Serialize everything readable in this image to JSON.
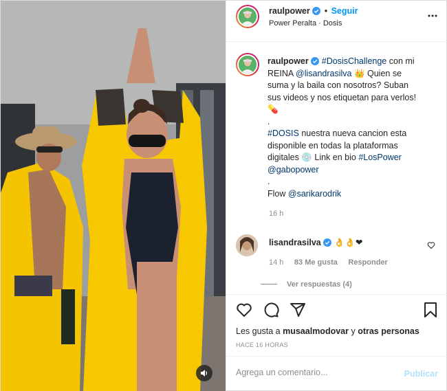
{
  "header": {
    "username": "raulpower",
    "separator": "•",
    "follow_label": "Seguir",
    "subtitle": "Power Peralta · Dosis",
    "more_icon": "more-options-icon"
  },
  "caption": {
    "username": "raulpower",
    "lines": [
      {
        "parts": [
          {
            "t": "#DosisChallenge",
            "blue": true
          },
          {
            "t": " con mi"
          }
        ]
      },
      {
        "parts": [
          {
            "t": "REINA "
          },
          {
            "t": "@lisandrasilva",
            "blue": true
          },
          {
            "t": " 👑 Quien se"
          }
        ]
      },
      {
        "parts": [
          {
            "t": "suma y la baila con nosotros? Suban"
          }
        ]
      },
      {
        "parts": [
          {
            "t": "sus videos y nos etiquetan para verlos!"
          }
        ]
      },
      {
        "parts": [
          {
            "t": "💊"
          }
        ]
      },
      {
        "parts": [
          {
            "t": "."
          }
        ]
      },
      {
        "parts": [
          {
            "t": "#DOSIS",
            "blue": true
          },
          {
            "t": " nuestra nueva cancion esta"
          }
        ]
      },
      {
        "parts": [
          {
            "t": "disponible en todas la plataformas"
          }
        ]
      },
      {
        "parts": [
          {
            "t": "digitales 💿 Link en bio "
          },
          {
            "t": "#LosPower",
            "blue": true
          }
        ]
      },
      {
        "parts": [
          {
            "t": "@gabopower",
            "blue": true
          }
        ]
      },
      {
        "parts": [
          {
            "t": "."
          }
        ]
      },
      {
        "parts": [
          {
            "t": "Flow "
          },
          {
            "t": "@sarikarodrik",
            "blue": true
          }
        ]
      }
    ],
    "time": "16 h"
  },
  "comment": {
    "username": "lisandrasilva",
    "text": " 👌👌❤",
    "time": "14 h",
    "likes": "83 Me gusta",
    "reply": "Responder",
    "view_replies": "Ver respuestas (4)"
  },
  "actions": {
    "likes_prefix": "Les gusta a ",
    "likes_user": "musaalmodovar",
    "likes_mid": " y ",
    "likes_others": "otras personas",
    "time_ago": "HACE 16 HORAS"
  },
  "add_comment": {
    "placeholder": "Agrega un comentario...",
    "post_label": "Publicar"
  },
  "colors": {
    "accent": "#0095f6",
    "robe": "#f5c400",
    "verified": "#3897f0"
  }
}
